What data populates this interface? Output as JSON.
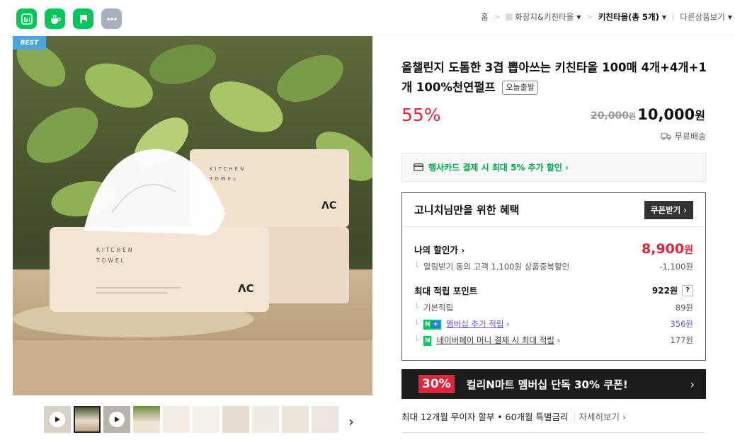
{
  "share_icons": [
    "blog-share-icon",
    "cafe-share-icon",
    "band-share-icon",
    "more-share-icon"
  ],
  "breadcrumb": {
    "home": "홈",
    "category": "화장지&키친타올",
    "current": "키친타올(총 5개)",
    "other": "다른상품보기"
  },
  "badge_best": "BEST",
  "product": {
    "title": "올챌린지 도톰한 3겹 뽑아쓰는 키친타올 100매 4개+4개+1개 100%천연펄프",
    "title_badge": "오늘출발",
    "discount_rate": "55%",
    "original_price": "20,000",
    "original_unit": "원",
    "price": "10,000",
    "price_unit": "원",
    "shipping": "무료배송"
  },
  "image_text": {
    "brand_line1": "KITCHEN",
    "brand_line2": "TOWEL",
    "logo": "ΛC"
  },
  "card_promo": "행사카드 결제 시 최대 5% 추가 할인 ›",
  "benefit": {
    "title": "고니치님만을 위한 혜택",
    "coupon_button": "쿠폰받기 ›",
    "my_price_label": "나의 할인가 ›",
    "my_price_value": "8,900",
    "my_price_unit": "원",
    "alarm_label": "알림받기 동의 고객 1,100원 상품중복할인",
    "alarm_value": "-1,100원",
    "points_label": "최대 적립 포인트",
    "points_value": "922원",
    "points_help": "?",
    "basic_label": "기본적립",
    "basic_value": "89원",
    "membership_label": "멤버십 추가 적립",
    "membership_value": "356원",
    "npay_label": "네이버페이 머니 결제 시 최대 적립",
    "npay_value": "177원"
  },
  "banner": {
    "badge": "30%",
    "text": "컬리N마트 멤버십 단독 30% 쿠폰!",
    "arrow": "›"
  },
  "installment": {
    "text": "최대 12개월 무이자 할부 • 60개월 특별금리",
    "more": "자세히보기 ›"
  },
  "colors": {
    "accent_red": "#e1253b",
    "naver_green": "#03c75a",
    "purple": "#6a4ed8",
    "best_blue": "#4aa4df"
  }
}
